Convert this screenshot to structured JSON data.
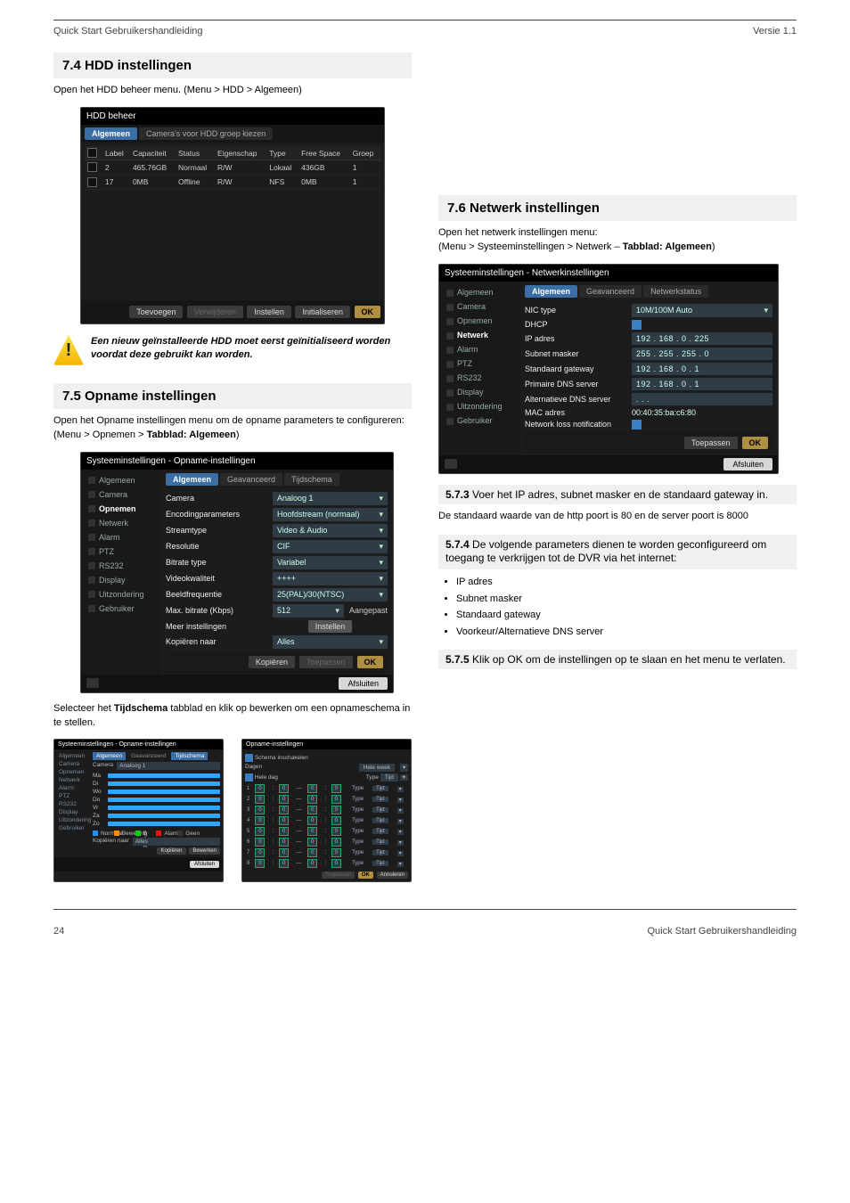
{
  "header": {
    "left": "Quick Start Gebruikershandleiding",
    "right": "Versie 1.1"
  },
  "footer": {
    "left": "24",
    "right": "Quick Start Gebruikershandleiding"
  },
  "left_column": {
    "sec7_4": {
      "title": "7.4 HDD instellingen"
    },
    "sec7_4_text": "Open het HDD beheer menu. (Menu > HDD > Algemeen)",
    "hdd_ss": {
      "title": "HDD beheer",
      "tabs": [
        "Algemeen",
        "Camera's voor HDD groep kiezen"
      ],
      "cols": [
        "",
        "Label",
        "Capaciteit",
        "Status",
        "Eigenschap",
        "Type",
        "Free Space",
        "Groep"
      ],
      "rows": [
        [
          "",
          "2",
          "465.76GB",
          "Normaal",
          "R/W",
          "Lokaal",
          "436GB",
          "1"
        ],
        [
          "",
          "17",
          "0MB",
          "Offline",
          "R/W",
          "NFS",
          "0MB",
          "1"
        ]
      ],
      "buttons": [
        "Toevoegen",
        "Verwijderen",
        "Instellen",
        "Initialiseren",
        "OK"
      ]
    },
    "warning": "Een nieuw geïnstalleerde HDD moet eerst geïnitialiseerd worden voordat deze gebruikt kan worden.",
    "sec7_5": {
      "title": "7.5 Opname instellingen"
    },
    "sec7_5_intro": {
      "before": "Open het Opname instellingen menu om de opname parameters te configureren:",
      "pre": "(Menu > Opnemen > ",
      "tab": "Tabblad: Algemeen",
      "after": ")"
    },
    "rec_ss": {
      "title": "Systeeminstellingen - Opname-instellingen",
      "nav": [
        "Algemeen",
        "Camera",
        "Opnemen",
        "Netwerk",
        "Alarm",
        "PTZ",
        "RS232",
        "Display",
        "Uitzondering",
        "Gebruiker"
      ],
      "nav_active": 2,
      "tabs": [
        "Algemeen",
        "Geavanceerd",
        "Tijdschema"
      ],
      "rows": [
        [
          "Camera",
          "Analoog 1"
        ],
        [
          "Encodingparameters",
          "Hoofdstream (normaal)"
        ],
        [
          "Streamtype",
          "Video & Audio"
        ],
        [
          "Resolutie",
          "CIF"
        ],
        [
          "Bitrate type",
          "Variabel"
        ],
        [
          "Videokwaliteit",
          "++++"
        ],
        [
          "Beeldfrequentie",
          "25(PAL)/30(NTSC)"
        ],
        [
          "Max. bitrate (Kbps)",
          "512",
          "Aangepast"
        ],
        [
          "Meer instellingen",
          "",
          "Instellen"
        ],
        [
          "Kopiëren naar",
          "Alles"
        ]
      ],
      "bottom_buttons": [
        "Kopiëren",
        "Toepassen",
        "OK"
      ],
      "close": "Afsluiten"
    },
    "schema_intro": {
      "pre": "Selecteer het ",
      "b": "Tijdschema",
      "post": " tabblad en klik op bewerken om een opnameschema in te stellen."
    },
    "mini_left": {
      "title": "Systeeminstellingen - Opname-instellingen",
      "tabs": [
        "Algemeen",
        "Geavanceerd",
        "Tijdschema"
      ],
      "camera_label": "Camera",
      "camera_value": "Analoog 1",
      "days": [
        "Ma",
        "Di",
        "Wo",
        "Do",
        "Vr",
        "Za",
        "Zo"
      ],
      "legend": [
        "Normaal",
        "Beweging",
        "B & A",
        "Alarm",
        "Geen"
      ],
      "copy_label": "Kopiëren naar",
      "copy_value": "Alles",
      "btns": [
        "Kopiëren",
        "Bewerken"
      ],
      "close": "Afsluiten"
    },
    "mini_right": {
      "title": "Opname-instellingen",
      "enable": "Schema inschakelen",
      "days_label": "Dagen",
      "days_value": "Hele week",
      "whole": "Hele dag",
      "type_label": "Type",
      "type_value": "Tijd",
      "row_count": 8,
      "btns": [
        "Toepassen",
        "OK",
        "Annuleren"
      ]
    }
  },
  "right_column": {
    "sec7_6": {
      "title": "7.6 Netwerk instellingen"
    },
    "sec7_6_text": {
      "pre": "Open het netwerk instellingen menu:",
      "path": "(Menu > Systeeminstellingen > Netwerk – ",
      "tab": "Tabblad: Algemeen",
      "after": ")"
    },
    "net_ss": {
      "title": "Systeeminstellingen - Netwerkinstellingen",
      "nav": [
        "Algemeen",
        "Camera",
        "Opnemen",
        "Netwerk",
        "Alarm",
        "PTZ",
        "RS232",
        "Display",
        "Uitzondering",
        "Gebruiker"
      ],
      "nav_active": 3,
      "tabs": [
        "Algemeen",
        "Geavanceerd",
        "Netwerkstatus"
      ],
      "rows": [
        [
          "NIC type",
          "10M/100M Auto",
          "dd"
        ],
        [
          "DHCP",
          "",
          "cb"
        ],
        [
          "IP adres",
          "192 . 168 . 0    . 225",
          "ip"
        ],
        [
          "Subnet masker",
          "255 . 255 . 255 . 0",
          "ip"
        ],
        [
          "Standaard gateway",
          "192 . 168 . 0    . 1",
          "ip"
        ],
        [
          "Primaire DNS server",
          "192 . 168 . 0    . 1",
          "ip"
        ],
        [
          "Alternatieve DNS server",
          ".       .       .",
          "ip"
        ],
        [
          "MAC adres",
          "00:40:35:ba:c6:80",
          "txt"
        ],
        [
          "Network loss notification",
          "",
          "cb"
        ]
      ],
      "bottom_buttons": [
        "Toepassen",
        "OK"
      ],
      "close": "Afsluiten"
    },
    "para573": {
      "num": "5.7.3",
      "rest": " Voer het IP adres, subnet masker en de standaard gateway in."
    },
    "para573_2": "De standaard waarde van de http poort is 80 en de server poort is 8000",
    "para574": {
      "num": "5.7.4",
      "rest": " De volgende parameters dienen te worden geconfigureerd om toegang te verkrijgen tot de DVR via het internet:"
    },
    "bullets": [
      "IP adres",
      "Subnet masker",
      "Standaard gateway",
      "Voorkeur/Alternatieve DNS server"
    ],
    "para575": {
      "num": "5.7.5",
      "rest": " Klik op OK om de instellingen op te slaan en het menu te verlaten."
    }
  }
}
